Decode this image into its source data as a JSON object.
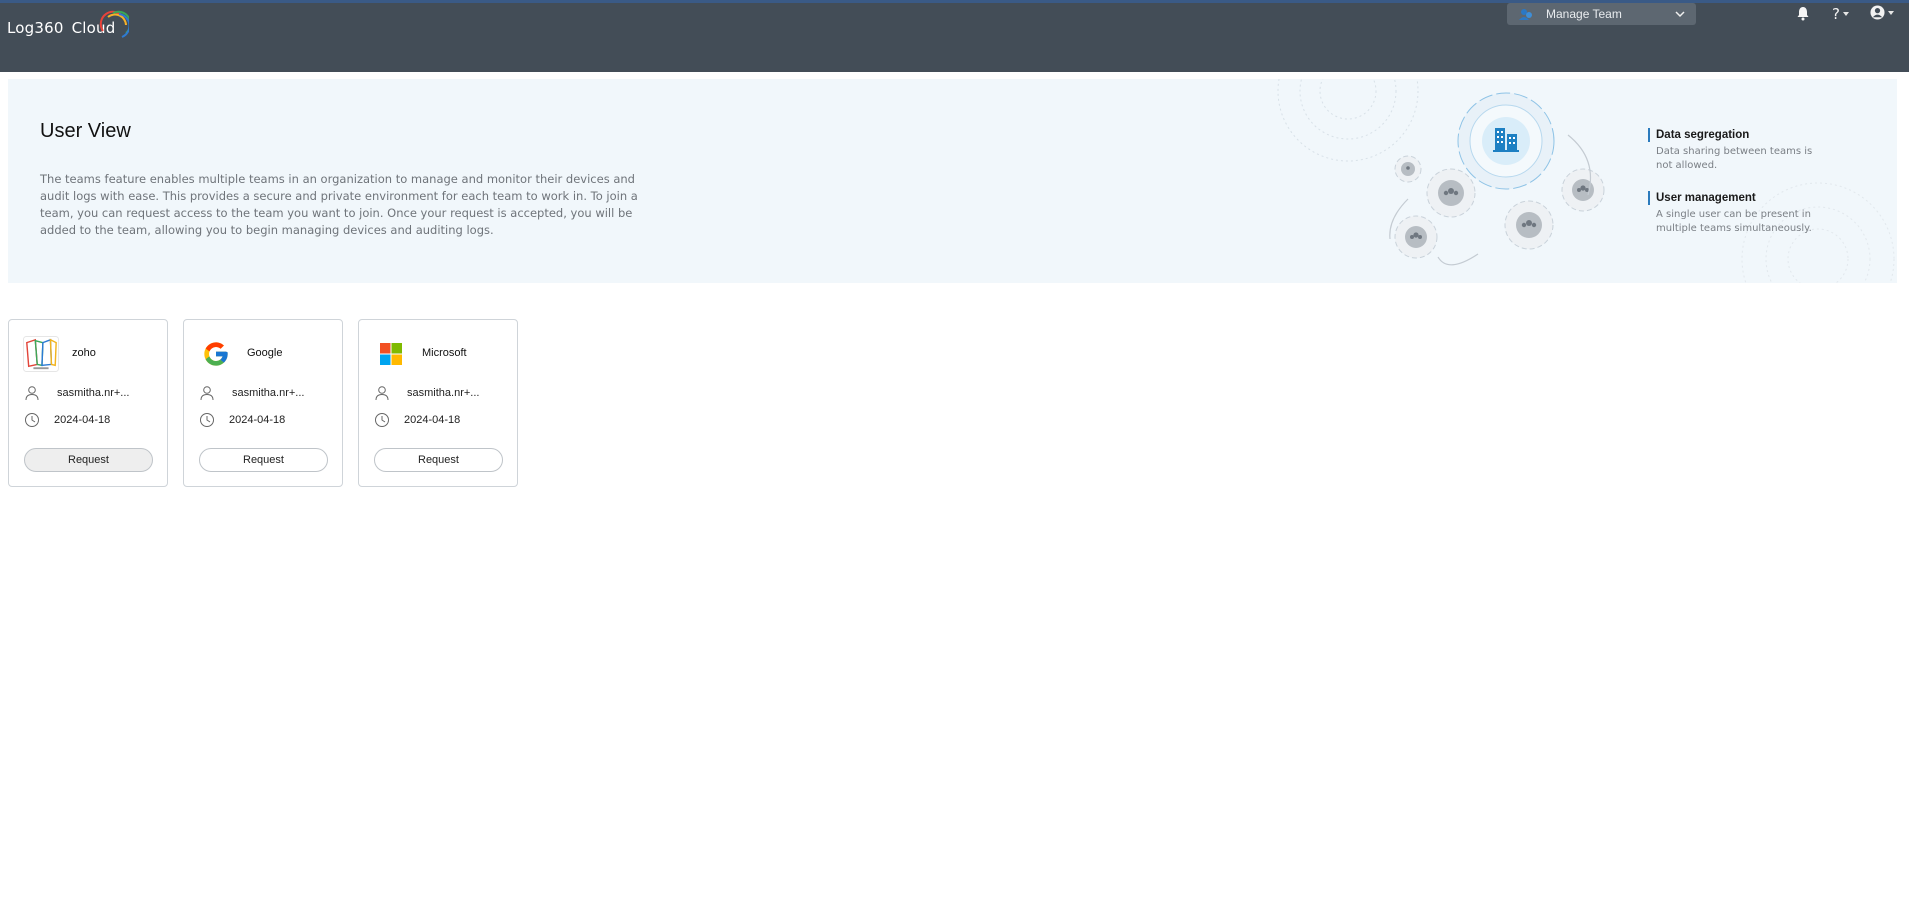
{
  "app": {
    "logo_text": "Log360",
    "logo_suffix": "Cloud",
    "manage_team_label": "Manage Team",
    "help_label": "?"
  },
  "banner": {
    "title": "User View",
    "description": "The teams feature enables multiple teams in an organization to manage and monitor their devices and audit logs with ease. This provides a secure and private environment for each team to work in. To join a team, you can request access to the team you want to join. Once your request is accepted, you will be added to the team, allowing you to begin managing devices and auditing logs.",
    "features": [
      {
        "title": "Data segregation",
        "desc": "Data sharing between teams is not allowed."
      },
      {
        "title": "User management",
        "desc": "A single user can be present in multiple teams simultaneously."
      }
    ]
  },
  "teams": [
    {
      "name": "zoho",
      "user": "sasmitha.nr+...",
      "date": "2024-04-18",
      "button": "Request",
      "icon": "zoho-logo-icon"
    },
    {
      "name": "Google",
      "user": "sasmitha.nr+...",
      "date": "2024-04-18",
      "button": "Request",
      "icon": "google-logo-icon"
    },
    {
      "name": "Microsoft",
      "user": "sasmitha.nr+...",
      "date": "2024-04-18",
      "button": "Request",
      "icon": "microsoft-logo-icon"
    }
  ],
  "colors": {
    "topbar": "#434d57",
    "banner_bg": "#f1f7fb",
    "accent": "#2b7bbd"
  }
}
